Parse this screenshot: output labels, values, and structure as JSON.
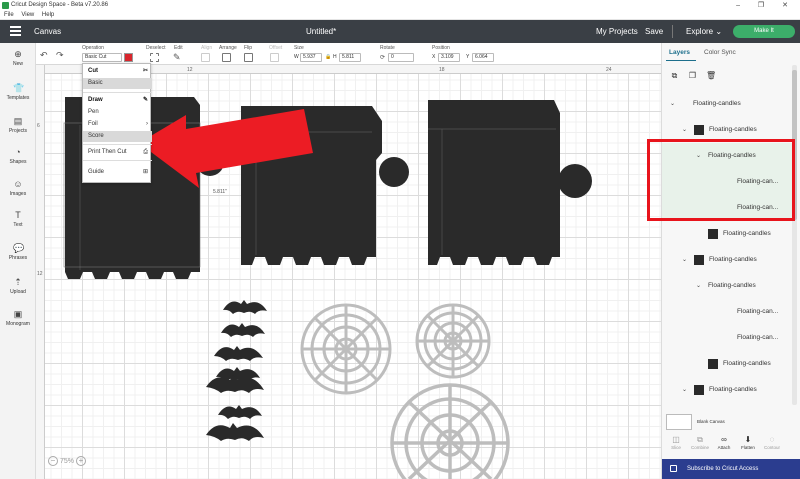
{
  "titlebar": {
    "title": "Cricut Design Space - Beta v7.20.86",
    "window_controls": "–  ❐  ✕"
  },
  "menubar": {
    "items": [
      "File",
      "View",
      "Help"
    ]
  },
  "header": {
    "section": "Canvas",
    "document_title": "Untitled*",
    "my_projects": "My Projects",
    "save": "Save",
    "explore": "Explore",
    "make_it": "Make It"
  },
  "toolbar": {
    "operation_label": "Operation",
    "operation_value": "Basic Cut",
    "operation_color": "#d9262d",
    "deselect_label": "Deselect",
    "edit_label": "Edit",
    "align_label": "Align",
    "arrange_label": "Arrange",
    "flip_label": "Flip",
    "offset_label": "Offset",
    "size_label": "Size",
    "size_w_label": "W",
    "size_w": "5.937",
    "size_h_label": "H",
    "size_h": "5.811",
    "rotate_label": "Rotate",
    "rotate_value": "0",
    "position_label": "Position",
    "pos_x_label": "X",
    "pos_x": "3.109",
    "pos_y_label": "Y",
    "pos_y": "6.064"
  },
  "leftbar": {
    "items": [
      {
        "icon": "plus-icon",
        "label": "New"
      },
      {
        "icon": "templates-icon",
        "label": "Templates"
      },
      {
        "icon": "projects-icon",
        "label": "Projects"
      },
      {
        "icon": "shapes-icon",
        "label": "Shapes"
      },
      {
        "icon": "images-icon",
        "label": "Images"
      },
      {
        "icon": "text-icon",
        "label": "Text"
      },
      {
        "icon": "phrases-icon",
        "label": "Phrases"
      },
      {
        "icon": "upload-icon",
        "label": "Upload"
      },
      {
        "icon": "monogram-icon",
        "label": "Monogram"
      }
    ]
  },
  "ruler": {
    "top": [
      "12",
      "18",
      "24"
    ],
    "left": [
      "6",
      "12"
    ]
  },
  "canvas": {
    "dimension_label": "5.811\""
  },
  "operation_menu": {
    "cut_header": "Cut",
    "basic": "Basic",
    "draw_header": "Draw",
    "pen": "Pen",
    "foil": "Foil",
    "score": "Score",
    "print_then_cut": "Print Then Cut",
    "guide": "Guide"
  },
  "zoom": {
    "minus": "−",
    "value": "75%",
    "plus": "+"
  },
  "rightpanel": {
    "tabs": [
      "Layers",
      "Color Sync"
    ],
    "layers": [
      {
        "level": 0,
        "chevron": "⌄",
        "name": "Floating-candles",
        "swatch": false,
        "highlight": false
      },
      {
        "level": 1,
        "chevron": "⌄",
        "name": "Floating-candles",
        "swatch": true,
        "highlight": false
      },
      {
        "level": 2,
        "chevron": "⌄",
        "name": "Floating-candles",
        "swatch": false,
        "highlight": true
      },
      {
        "level": 3,
        "chevron": "",
        "name": "Floating-can...",
        "swatch": false,
        "highlight": true
      },
      {
        "level": 3,
        "chevron": "",
        "name": "Floating-can...",
        "swatch": false,
        "highlight": true
      },
      {
        "level": 2,
        "chevron": "",
        "name": "Floating-candles",
        "swatch": true,
        "highlight": false
      },
      {
        "level": 1,
        "chevron": "⌄",
        "name": "Floating-candles",
        "swatch": true,
        "highlight": false
      },
      {
        "level": 2,
        "chevron": "⌄",
        "name": "Floating-candles",
        "swatch": false,
        "highlight": false
      },
      {
        "level": 3,
        "chevron": "",
        "name": "Floating-can...",
        "swatch": false,
        "highlight": false
      },
      {
        "level": 3,
        "chevron": "",
        "name": "Floating-can...",
        "swatch": false,
        "highlight": false
      },
      {
        "level": 2,
        "chevron": "",
        "name": "Floating-candles",
        "swatch": true,
        "highlight": false
      },
      {
        "level": 1,
        "chevron": "⌄",
        "name": "Floating-candles",
        "swatch": true,
        "highlight": false
      },
      {
        "level": 2,
        "chevron": "⌄",
        "name": "Floating-candles",
        "swatch": false,
        "highlight": false
      }
    ],
    "blank_canvas": "Blank Canvas",
    "bottom_tools": [
      {
        "icon": "slice-icon",
        "label": "Slice",
        "enabled": false
      },
      {
        "icon": "combine-icon",
        "label": "Combine",
        "enabled": false
      },
      {
        "icon": "attach-icon",
        "label": "Attach",
        "enabled": true
      },
      {
        "icon": "flatten-icon",
        "label": "Flatten",
        "enabled": true
      },
      {
        "icon": "contour-icon",
        "label": "Contour",
        "enabled": false
      }
    ],
    "subscribe": "Subscribe to Cricut Access"
  },
  "colors": {
    "header_bg": "#3a3f45",
    "make_it": "#3cae6a",
    "annotation_red": "#e8141c",
    "shape_fill": "#2a2a2a",
    "subscribe_bg": "#2b3d8f"
  }
}
